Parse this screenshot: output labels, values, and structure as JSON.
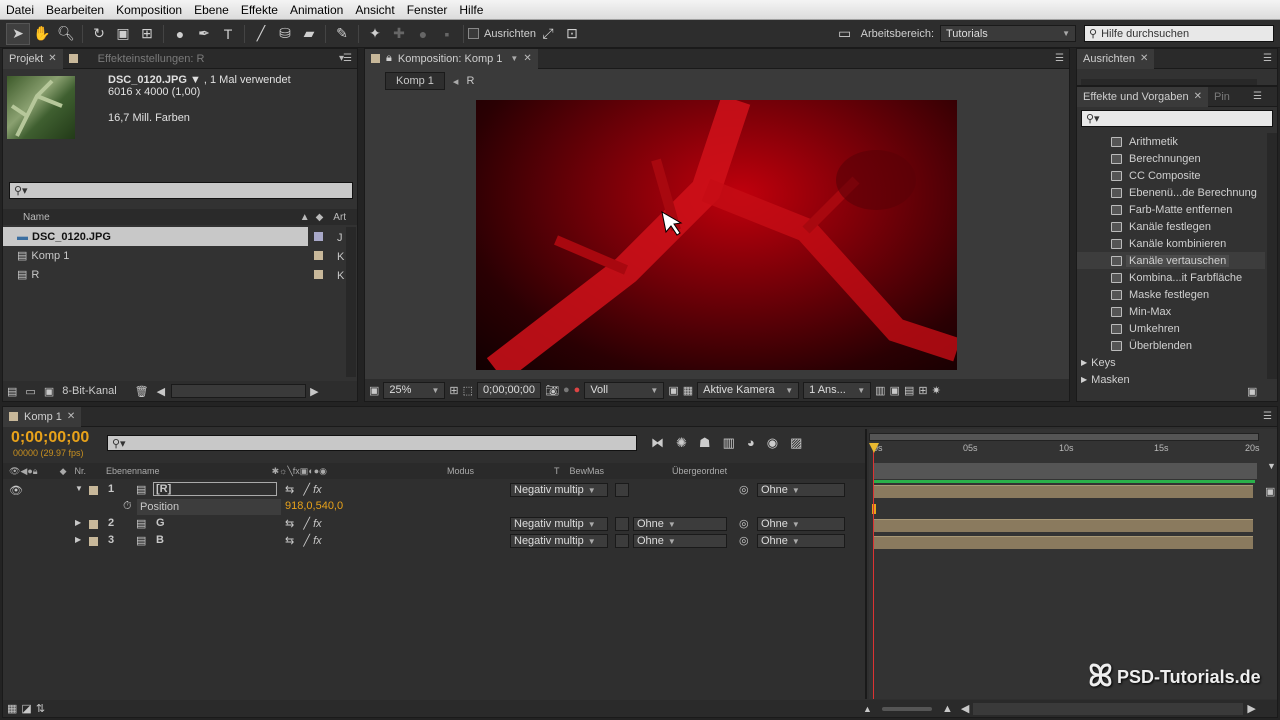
{
  "menu": [
    "Datei",
    "Bearbeiten",
    "Komposition",
    "Ebene",
    "Effekte",
    "Animation",
    "Ansicht",
    "Fenster",
    "Hilfe"
  ],
  "toolbar": {
    "align_label": "Ausrichten",
    "workspace_label": "Arbeitsbereich:",
    "workspace_value": "Tutorials",
    "help_placeholder": "Hilfe durchsuchen"
  },
  "project": {
    "tab_project": "Projekt",
    "tab_effects": "Effekteinstellungen: R",
    "file_name": "DSC_0120.JPG",
    "file_usage": ", 1 Mal verwendet",
    "file_dims": "6016 x 4000 (1,00)",
    "file_colors": "16,7 Mill. Farben",
    "col_name": "Name",
    "col_type": "Art",
    "items": [
      {
        "name": "DSC_0120.JPG",
        "color": "#a8a8c8",
        "type": "J"
      },
      {
        "name": "Komp 1",
        "color": "#c8b89a",
        "type": "K"
      },
      {
        "name": "R",
        "color": "#c8b89a",
        "type": "K"
      }
    ],
    "bit_depth": "8-Bit-Kanal"
  },
  "composition": {
    "tab_label": "Komposition: Komp 1",
    "breadcrumb": [
      "Komp 1",
      "R"
    ],
    "zoom": "25%",
    "timecode": "0;00;00;00",
    "resolution": "Voll",
    "camera": "Aktive Kamera",
    "views": "1 Ans..."
  },
  "align_panel": {
    "tab": "Ausrichten"
  },
  "effects_panel": {
    "tab": "Effekte und Vorgaben",
    "tab2": "Pin",
    "items": [
      "Arithmetik",
      "Berechnungen",
      "CC Composite",
      "Ebenenü...de Berechnung",
      "Farb-Matte entfernen",
      "Kanäle festlegen",
      "Kanäle kombinieren",
      "Kanäle vertauschen",
      "Kombina...it Farbfläche",
      "Maske festlegen",
      "Min-Max",
      "Umkehren",
      "Überblenden"
    ],
    "selected": "Kanäle vertauschen",
    "groups": [
      "Keys",
      "Masken"
    ]
  },
  "timeline": {
    "tab": "Komp 1",
    "timecode": "0;00;00;00",
    "fps": "00000 (29.97 fps)",
    "headers": {
      "nr": "Nr.",
      "name": "Ebenenname",
      "mode": "Modus",
      "t": "T",
      "trkmat": "BewMas",
      "parent": "Übergeordnet"
    },
    "layers": [
      {
        "nr": "1",
        "name": "[R]",
        "mode": "Negativ multip",
        "trkmat": "",
        "parent": "Ohne"
      },
      {
        "nr": "2",
        "name": "G",
        "mode": "Negativ multip",
        "trkmat": "Ohne",
        "parent": "Ohne"
      },
      {
        "nr": "3",
        "name": "B",
        "mode": "Negativ multip",
        "trkmat": "Ohne",
        "parent": "Ohne"
      }
    ],
    "property": {
      "name": "Position",
      "value": "918,0,540,0"
    },
    "ruler": [
      "0s",
      "05s",
      "10s",
      "15s",
      "20s"
    ]
  },
  "watermark": "PSD-Tutorials.de"
}
